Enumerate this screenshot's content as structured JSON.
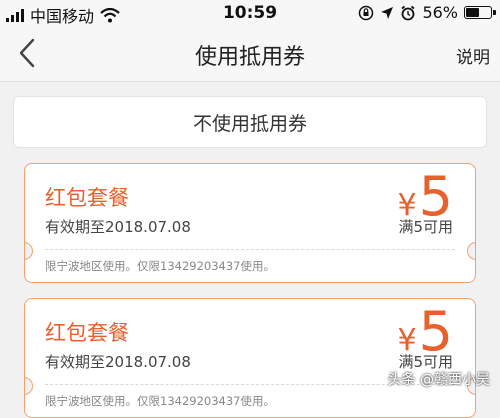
{
  "status_bar": {
    "carrier": "中国移动",
    "time": "10:59",
    "battery_percent": "56%",
    "battery_level": 0.56,
    "icons": [
      "signal-icon",
      "wifi-icon",
      "rotation-lock-icon",
      "location-icon",
      "alarm-icon",
      "battery-icon"
    ]
  },
  "nav": {
    "title": "使用抵用券",
    "right_label": "说明",
    "back_icon": "chevron-left-icon"
  },
  "no_coupon_label": "不使用抵用券",
  "coupons": [
    {
      "title": "红包套餐",
      "expiry": "有效期至2018.07.08",
      "currency": "¥",
      "amount": "5",
      "condition": "满5可用",
      "note": "限宁波地区使用。仅限13429203437使用。"
    },
    {
      "title": "红包套餐",
      "expiry": "有效期至2018.07.08",
      "currency": "¥",
      "amount": "5",
      "condition": "满5可用",
      "note": "限宁波地区使用。仅限13429203437使用。"
    }
  ],
  "watermark": "头条 @赣西小吴",
  "colors": {
    "accent": "#e8602c",
    "coupon_border": "#f0a273",
    "background": "#f1f1f1"
  }
}
